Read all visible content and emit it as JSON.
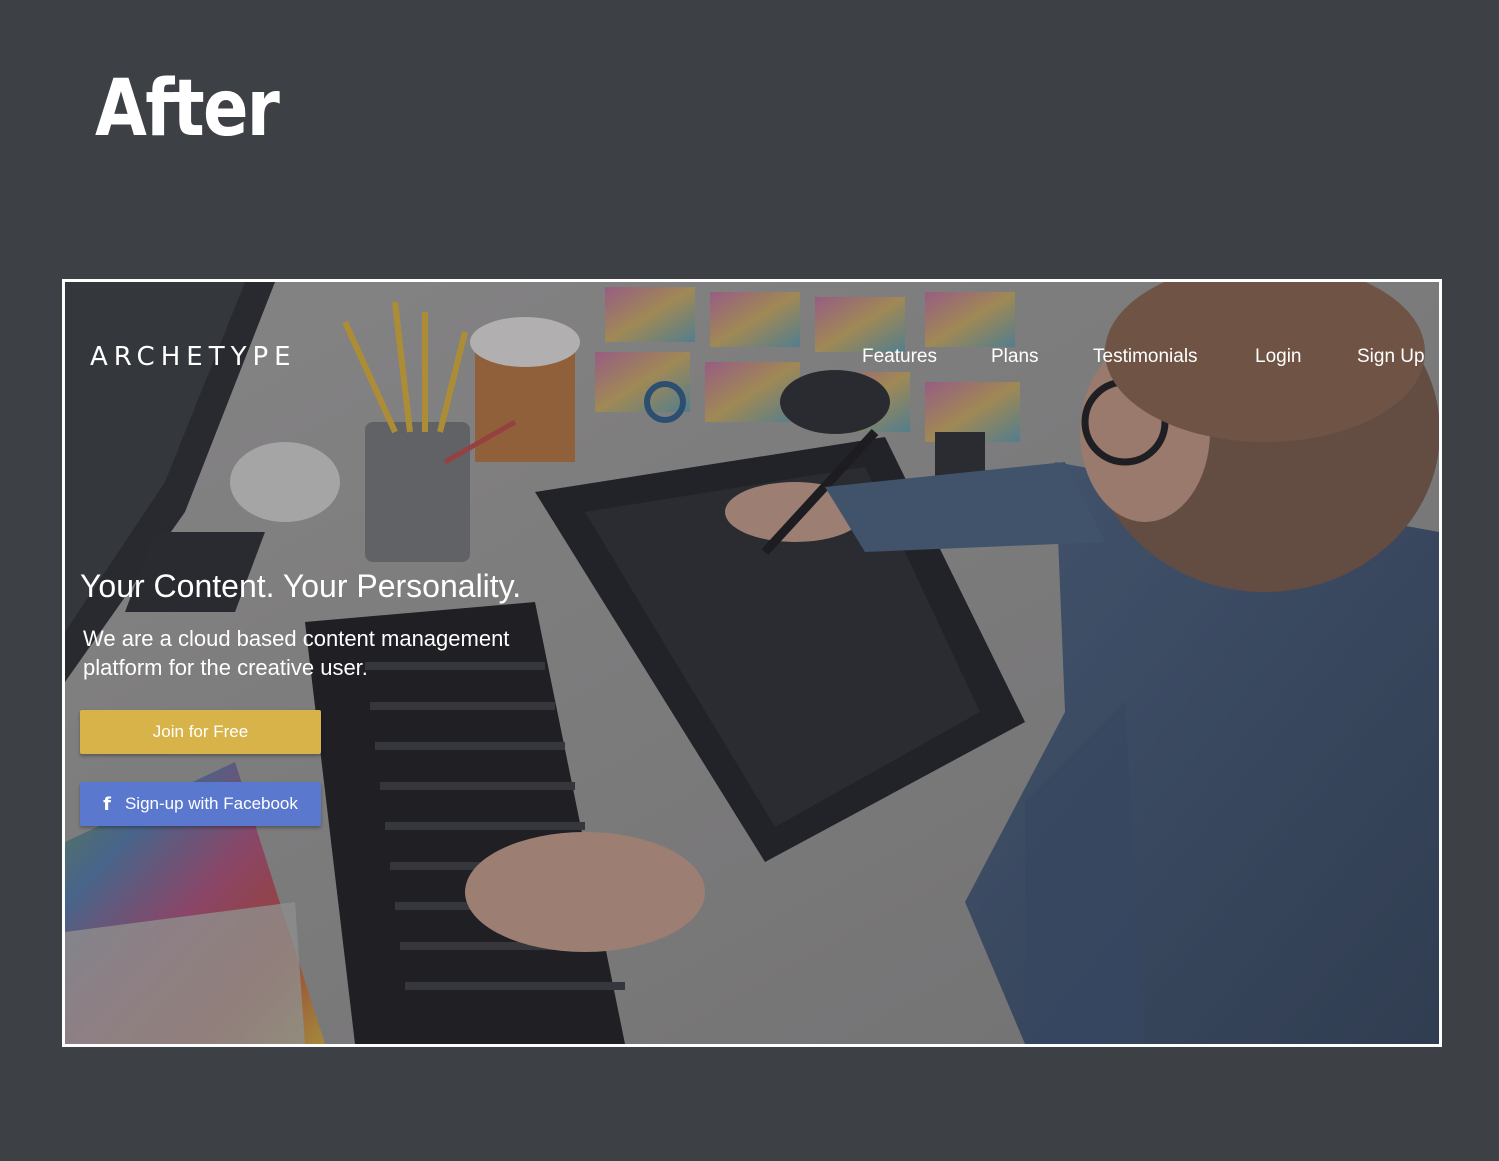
{
  "slide": {
    "title": "After"
  },
  "site": {
    "logo": "ARCHETYPE",
    "nav": [
      "Features",
      "Plans",
      "Testimonials",
      "Login",
      "Sign Up"
    ],
    "hero_title": "Your Content. Your Personality.",
    "hero_subtitle": "We are a cloud based content management platform for the creative user.",
    "join_button": "Join for Free",
    "facebook_button": "Sign-up with Facebook",
    "facebook_icon": "facebook-icon"
  },
  "colors": {
    "page_background": "#3d4045",
    "join_button": "#d8b34a",
    "facebook_button": "#5b78cf"
  }
}
